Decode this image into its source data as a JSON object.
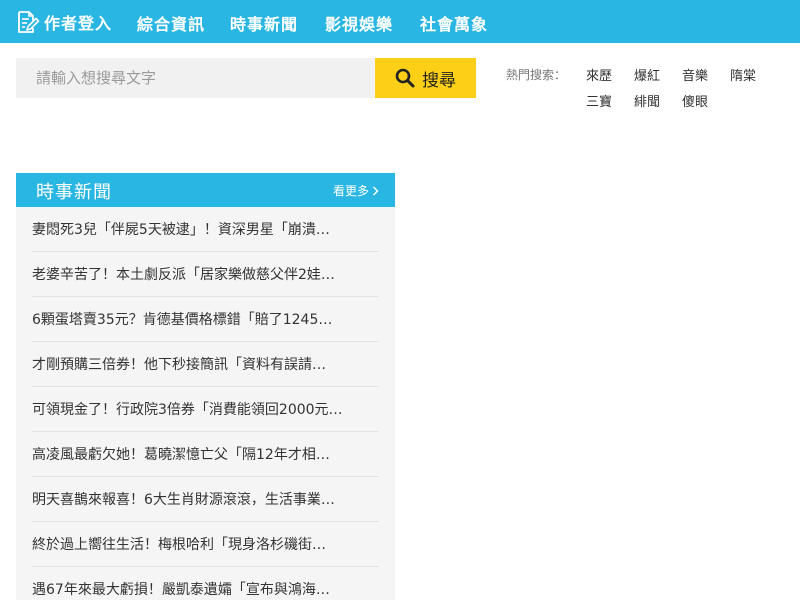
{
  "header": {
    "brand": {
      "label": "作者登入",
      "icon": "edit-document-icon"
    },
    "nav": [
      "綜合資訊",
      "時事新聞",
      "影視娛樂",
      "社會萬象"
    ]
  },
  "search": {
    "placeholder": "請輸入想搜尋文字",
    "value": "",
    "button_label": "搜尋",
    "button_icon": "search-icon"
  },
  "hot": {
    "label": "熱門搜索：",
    "keywords": [
      "來歷",
      "爆紅",
      "音樂",
      "隋棠",
      "三寶",
      "緋聞",
      "傻眼"
    ]
  },
  "news": {
    "title": "時事新聞",
    "more_label": "看更多",
    "items": [
      "妻悶死3兒「伴屍5天被逮」！資深男星「崩潰…",
      "老婆辛苦了！本土劇反派「居家樂做慈父伴2娃…",
      "6顆蛋塔賣35元？肯德基價格標錯「賠了1245…",
      "才剛預購三倍券！他下秒接簡訊「資料有誤請…",
      "可領現金了！行政院3倍券「消費能領回2000元…",
      "高凌風最虧欠她！葛曉潔憶亡父「隔12年才相…",
      "明天喜鵲來報喜！6大生肖財源滾滾，生活事業…",
      "終於過上嚮往生活！梅根哈利「現身洛杉磯街…",
      "遇67年來最大虧損！嚴凱泰遺孀「宣布與鴻海…"
    ]
  },
  "colors": {
    "primary": "#29b6e2",
    "accent": "#fdd017",
    "list_background": "#f5f5f5",
    "search_background": "#f1f1f1"
  }
}
